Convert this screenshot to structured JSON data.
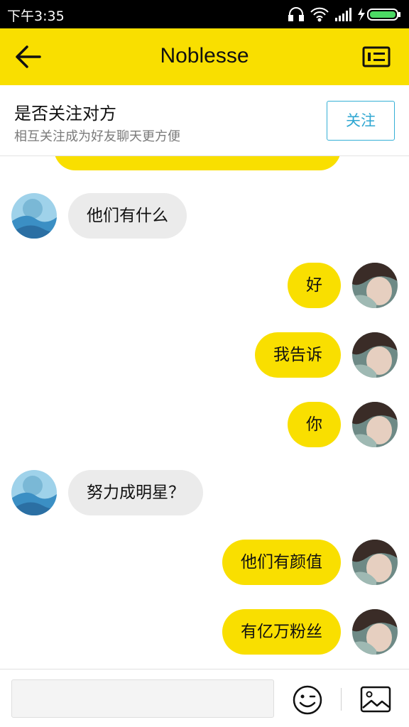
{
  "status_bar": {
    "time": "下午3:35",
    "icons": [
      "headset-icon",
      "wifi-icon",
      "signal-icon",
      "charging-icon",
      "battery-icon"
    ]
  },
  "header": {
    "back_icon": "arrow-left-icon",
    "title": "Noblesse",
    "profile_icon": "id-card-icon"
  },
  "follow_banner": {
    "title": "是否关注对方",
    "subtitle": "相互关注成为好友聊天更方便",
    "button_label": "关注"
  },
  "messages": [
    {
      "side": "left",
      "text": "他们有什么"
    },
    {
      "side": "right",
      "text": "好"
    },
    {
      "side": "right",
      "text": "我告诉"
    },
    {
      "side": "right",
      "text": "你"
    },
    {
      "side": "left",
      "text": "努力成明星？"
    },
    {
      "side": "right",
      "text": "他们有颜值"
    },
    {
      "side": "right",
      "text": "有亿万粉丝"
    }
  ],
  "input_bar": {
    "placeholder": "",
    "emoji_icon": "smiley-icon",
    "image_icon": "image-icon"
  },
  "colors": {
    "brand_yellow": "#f9df00",
    "incoming_bubble": "#ebebeb",
    "follow_blue": "#2fa7d2"
  }
}
